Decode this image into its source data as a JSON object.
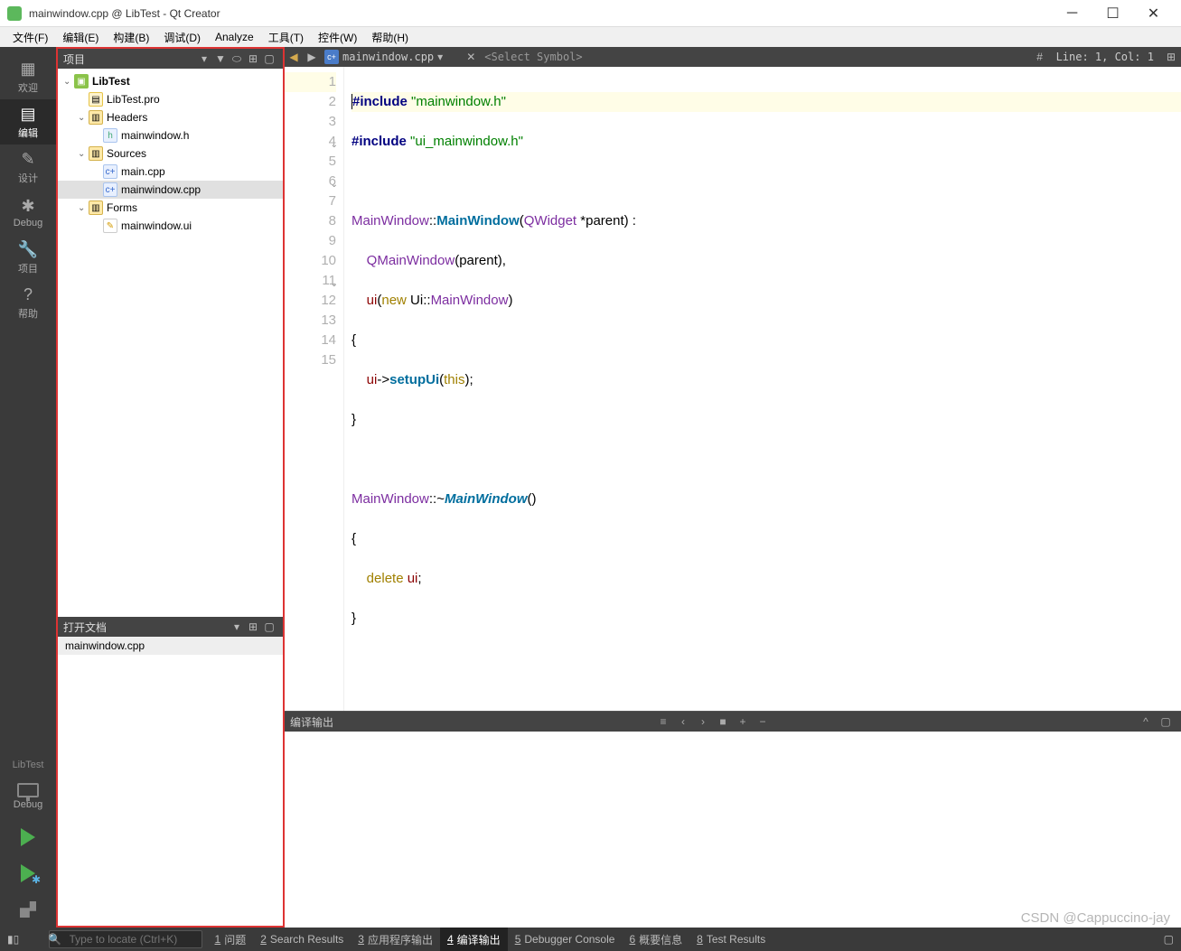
{
  "window": {
    "title": "mainwindow.cpp @ LibTest - Qt Creator"
  },
  "menu": {
    "file": "文件(F)",
    "edit": "编辑(E)",
    "build": "构建(B)",
    "debug": "调试(D)",
    "analyze": "Analyze",
    "tools": "工具(T)",
    "widgets": "控件(W)",
    "help": "帮助(H)"
  },
  "leftbar": {
    "welcome": "欢迎",
    "edit": "编辑",
    "design": "设计",
    "debug": "Debug",
    "projects": "项目",
    "help": "帮助",
    "kit": "LibTest",
    "kitmode": "Debug"
  },
  "projectPanel": {
    "title": "项目",
    "tree": {
      "root": "LibTest",
      "pro": "LibTest.pro",
      "headers": "Headers",
      "header0": "mainwindow.h",
      "sources": "Sources",
      "source0": "main.cpp",
      "source1": "mainwindow.cpp",
      "forms": "Forms",
      "form0": "mainwindow.ui"
    }
  },
  "openDocs": {
    "title": "打开文档",
    "items": [
      "mainwindow.cpp"
    ]
  },
  "editorBar": {
    "file": "mainwindow.cpp",
    "symbol": "<Select Symbol>",
    "position": "Line: 1, Col: 1"
  },
  "code": {
    "lines": 15,
    "l1a": "#include ",
    "l1b": "\"mainwindow.h\"",
    "l2a": "#include ",
    "l2b": "\"ui_mainwindow.h\"",
    "l4a": "MainWindow",
    "l4b": "::",
    "l4c": "MainWindow",
    "l4d": "(",
    "l4e": "QWidget",
    "l4f": " *parent) :",
    "l5a": "    QMainWindow",
    "l5b": "(parent),",
    "l6a": "    ",
    "l6b": "ui",
    "l6c": "(",
    "l6d": "new",
    "l6e": " Ui::",
    "l6f": "MainWindow",
    "l6g": ")",
    "l7": "{",
    "l8a": "    ",
    "l8b": "ui",
    "l8c": "->",
    "l8d": "setupUi",
    "l8e": "(",
    "l8f": "this",
    "l8g": ");",
    "l9": "}",
    "l11a": "MainWindow",
    "l11b": "::~",
    "l11c": "MainWindow",
    "l11d": "()",
    "l12": "{",
    "l13a": "    ",
    "l13b": "delete",
    "l13c": " ",
    "l13d": "ui",
    "l13e": ";",
    "l14": "}"
  },
  "output": {
    "title": "编译输出"
  },
  "status": {
    "locator_placeholder": "Type to locate (Ctrl+K)",
    "t1": "问题",
    "t2": "Search Results",
    "t3": "应用程序输出",
    "t4": "编译输出",
    "t5": "Debugger Console",
    "t6": "概要信息",
    "t8": "Test Results"
  },
  "watermark": "CSDN @Cappuccino-jay"
}
